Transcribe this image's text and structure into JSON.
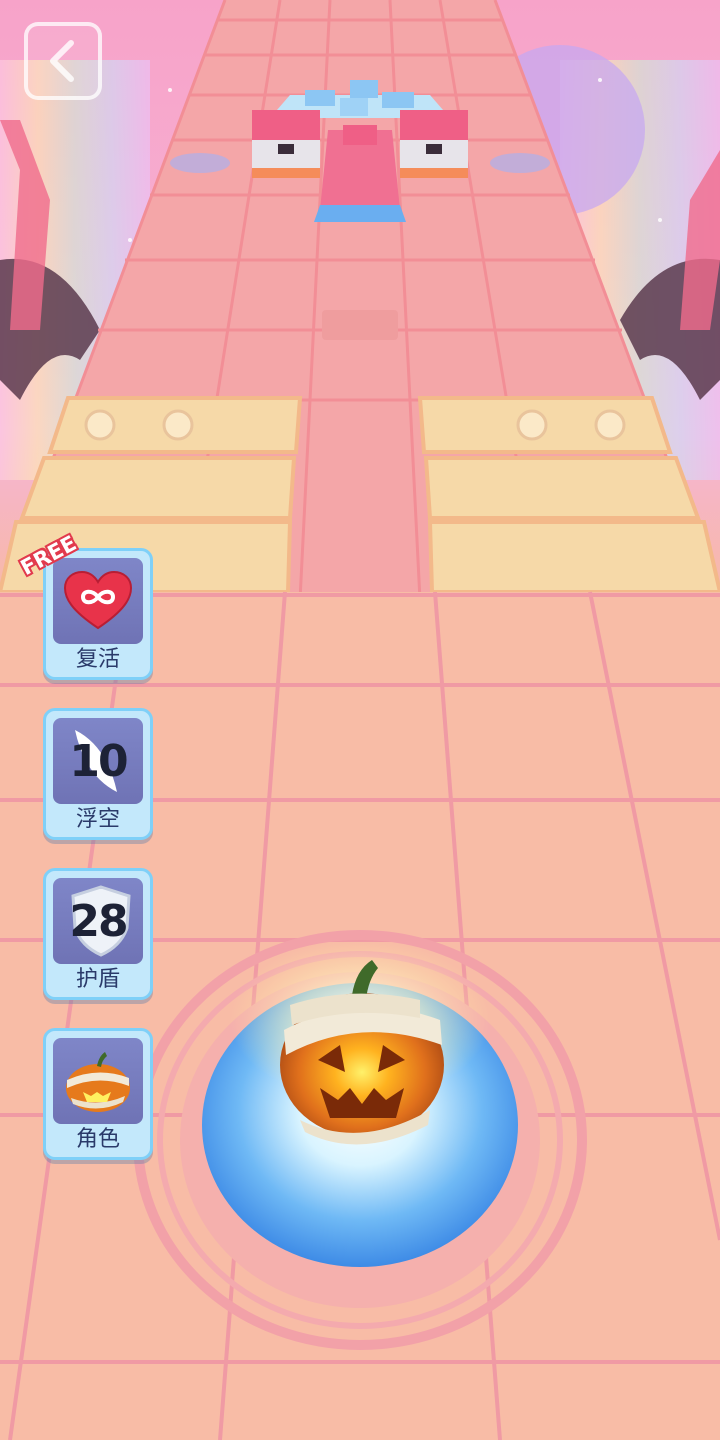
{
  "back_icon": "chevron-left-icon",
  "powerups": {
    "revive": {
      "label": "复活",
      "badge": "FREE",
      "icon": "infinity-heart-icon"
    },
    "float": {
      "label": "浮空",
      "count": "10",
      "icon": "feather-icon"
    },
    "shield": {
      "label": "护盾",
      "count": "28",
      "icon": "shield-icon"
    },
    "character": {
      "label": "角色",
      "icon": "mummy-pumpkin-icon"
    }
  },
  "player": {
    "character": "mummy-pumpkin"
  },
  "colors": {
    "sky_pink": "#f7a3c9",
    "floor": "#f8bca6",
    "floor_lines": "#f09aa4",
    "button_border": "#7fd0f8",
    "button_face": "#7077b8",
    "heart": "#e8334a",
    "portal_blue": "#5fa9f0"
  }
}
